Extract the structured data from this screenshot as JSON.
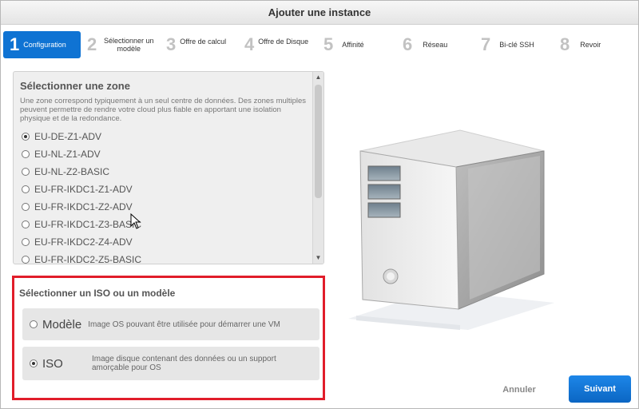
{
  "window": {
    "title": "Ajouter une instance"
  },
  "steps": [
    {
      "num": "1",
      "label": "Configuration"
    },
    {
      "num": "2",
      "label": "Sélectionner un modèle"
    },
    {
      "num": "3",
      "label": "Offre de calcul"
    },
    {
      "num": "4",
      "label": "Offre de Disque"
    },
    {
      "num": "5",
      "label": "Affinité"
    },
    {
      "num": "6",
      "label": "Réseau"
    },
    {
      "num": "7",
      "label": "Bi-clé SSH"
    },
    {
      "num": "8",
      "label": "Revoir"
    }
  ],
  "zone": {
    "title": "Sélectionner une zone",
    "description": "Une zone correspond typiquement à un seul centre de données. Des zones multiples peuvent permettre de rendre votre cloud plus fiable en apportant une isolation physique et de la redondance.",
    "items": [
      {
        "label": "EU-DE-Z1-ADV"
      },
      {
        "label": "EU-NL-Z1-ADV"
      },
      {
        "label": "EU-NL-Z2-BASIC"
      },
      {
        "label": "EU-FR-IKDC1-Z1-ADV"
      },
      {
        "label": "EU-FR-IKDC1-Z2-ADV"
      },
      {
        "label": "EU-FR-IKDC1-Z3-BASIC"
      },
      {
        "label": "EU-FR-IKDC2-Z4-ADV"
      },
      {
        "label": "EU-FR-IKDC2-Z5-BASIC"
      }
    ],
    "selected": "EU-DE-Z1-ADV"
  },
  "iso_section": {
    "title": "Sélectionner un ISO ou un modèle",
    "options": [
      {
        "name": "Modèle",
        "description": "Image OS pouvant être utilisée pour démarrer une VM"
      },
      {
        "name": "ISO",
        "description": "Image disque contenant des données ou un support amorçable pour OS"
      }
    ],
    "selected": "ISO"
  },
  "buttons": {
    "cancel": "Annuler",
    "next": "Suivant"
  },
  "colors": {
    "accent": "#0f73d3",
    "highlight_border": "#e11d2a"
  },
  "icons": {
    "cursor": "mouse-pointer-icon",
    "illustration": "server-tower-icon"
  }
}
